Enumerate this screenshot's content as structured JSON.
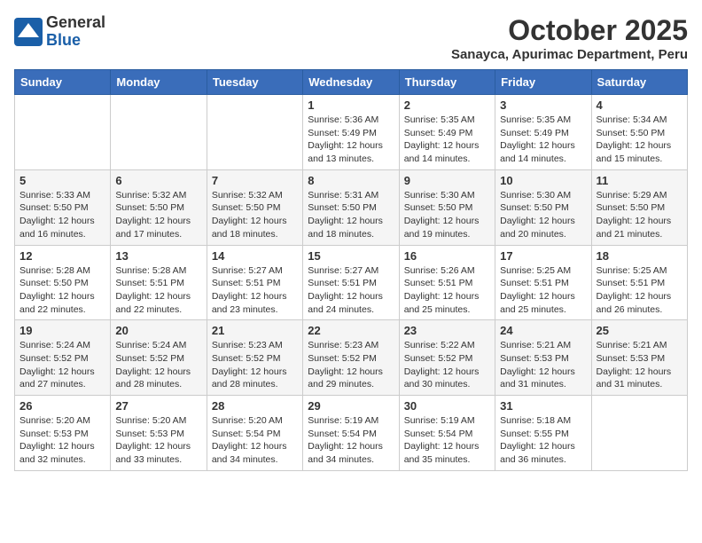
{
  "logo": {
    "general": "General",
    "blue": "Blue"
  },
  "title": "October 2025",
  "subtitle": "Sanayca, Apurimac Department, Peru",
  "weekdays": [
    "Sunday",
    "Monday",
    "Tuesday",
    "Wednesday",
    "Thursday",
    "Friday",
    "Saturday"
  ],
  "weeks": [
    [
      {
        "day": "",
        "info": ""
      },
      {
        "day": "",
        "info": ""
      },
      {
        "day": "",
        "info": ""
      },
      {
        "day": "1",
        "info": "Sunrise: 5:36 AM\nSunset: 5:49 PM\nDaylight: 12 hours\nand 13 minutes."
      },
      {
        "day": "2",
        "info": "Sunrise: 5:35 AM\nSunset: 5:49 PM\nDaylight: 12 hours\nand 14 minutes."
      },
      {
        "day": "3",
        "info": "Sunrise: 5:35 AM\nSunset: 5:49 PM\nDaylight: 12 hours\nand 14 minutes."
      },
      {
        "day": "4",
        "info": "Sunrise: 5:34 AM\nSunset: 5:50 PM\nDaylight: 12 hours\nand 15 minutes."
      }
    ],
    [
      {
        "day": "5",
        "info": "Sunrise: 5:33 AM\nSunset: 5:50 PM\nDaylight: 12 hours\nand 16 minutes."
      },
      {
        "day": "6",
        "info": "Sunrise: 5:32 AM\nSunset: 5:50 PM\nDaylight: 12 hours\nand 17 minutes."
      },
      {
        "day": "7",
        "info": "Sunrise: 5:32 AM\nSunset: 5:50 PM\nDaylight: 12 hours\nand 18 minutes."
      },
      {
        "day": "8",
        "info": "Sunrise: 5:31 AM\nSunset: 5:50 PM\nDaylight: 12 hours\nand 18 minutes."
      },
      {
        "day": "9",
        "info": "Sunrise: 5:30 AM\nSunset: 5:50 PM\nDaylight: 12 hours\nand 19 minutes."
      },
      {
        "day": "10",
        "info": "Sunrise: 5:30 AM\nSunset: 5:50 PM\nDaylight: 12 hours\nand 20 minutes."
      },
      {
        "day": "11",
        "info": "Sunrise: 5:29 AM\nSunset: 5:50 PM\nDaylight: 12 hours\nand 21 minutes."
      }
    ],
    [
      {
        "day": "12",
        "info": "Sunrise: 5:28 AM\nSunset: 5:50 PM\nDaylight: 12 hours\nand 22 minutes."
      },
      {
        "day": "13",
        "info": "Sunrise: 5:28 AM\nSunset: 5:51 PM\nDaylight: 12 hours\nand 22 minutes."
      },
      {
        "day": "14",
        "info": "Sunrise: 5:27 AM\nSunset: 5:51 PM\nDaylight: 12 hours\nand 23 minutes."
      },
      {
        "day": "15",
        "info": "Sunrise: 5:27 AM\nSunset: 5:51 PM\nDaylight: 12 hours\nand 24 minutes."
      },
      {
        "day": "16",
        "info": "Sunrise: 5:26 AM\nSunset: 5:51 PM\nDaylight: 12 hours\nand 25 minutes."
      },
      {
        "day": "17",
        "info": "Sunrise: 5:25 AM\nSunset: 5:51 PM\nDaylight: 12 hours\nand 25 minutes."
      },
      {
        "day": "18",
        "info": "Sunrise: 5:25 AM\nSunset: 5:51 PM\nDaylight: 12 hours\nand 26 minutes."
      }
    ],
    [
      {
        "day": "19",
        "info": "Sunrise: 5:24 AM\nSunset: 5:52 PM\nDaylight: 12 hours\nand 27 minutes."
      },
      {
        "day": "20",
        "info": "Sunrise: 5:24 AM\nSunset: 5:52 PM\nDaylight: 12 hours\nand 28 minutes."
      },
      {
        "day": "21",
        "info": "Sunrise: 5:23 AM\nSunset: 5:52 PM\nDaylight: 12 hours\nand 28 minutes."
      },
      {
        "day": "22",
        "info": "Sunrise: 5:23 AM\nSunset: 5:52 PM\nDaylight: 12 hours\nand 29 minutes."
      },
      {
        "day": "23",
        "info": "Sunrise: 5:22 AM\nSunset: 5:52 PM\nDaylight: 12 hours\nand 30 minutes."
      },
      {
        "day": "24",
        "info": "Sunrise: 5:21 AM\nSunset: 5:53 PM\nDaylight: 12 hours\nand 31 minutes."
      },
      {
        "day": "25",
        "info": "Sunrise: 5:21 AM\nSunset: 5:53 PM\nDaylight: 12 hours\nand 31 minutes."
      }
    ],
    [
      {
        "day": "26",
        "info": "Sunrise: 5:20 AM\nSunset: 5:53 PM\nDaylight: 12 hours\nand 32 minutes."
      },
      {
        "day": "27",
        "info": "Sunrise: 5:20 AM\nSunset: 5:53 PM\nDaylight: 12 hours\nand 33 minutes."
      },
      {
        "day": "28",
        "info": "Sunrise: 5:20 AM\nSunset: 5:54 PM\nDaylight: 12 hours\nand 34 minutes."
      },
      {
        "day": "29",
        "info": "Sunrise: 5:19 AM\nSunset: 5:54 PM\nDaylight: 12 hours\nand 34 minutes."
      },
      {
        "day": "30",
        "info": "Sunrise: 5:19 AM\nSunset: 5:54 PM\nDaylight: 12 hours\nand 35 minutes."
      },
      {
        "day": "31",
        "info": "Sunrise: 5:18 AM\nSunset: 5:55 PM\nDaylight: 12 hours\nand 36 minutes."
      },
      {
        "day": "",
        "info": ""
      }
    ]
  ]
}
